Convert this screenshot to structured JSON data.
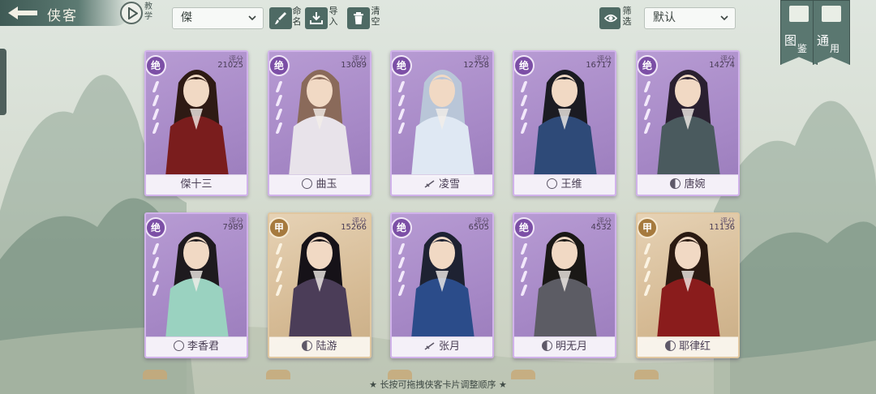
{
  "header": {
    "title": "侠客",
    "tutorial_label": "教学",
    "filter_select": "傑",
    "rename_label": "命名",
    "import_label": "导入",
    "clear_label": "清空",
    "screen_label": "筛选",
    "sort_select": "默认",
    "codex_label_1": "图",
    "codex_label_2": "鉴",
    "general_label_1": "通",
    "general_label_2": "用"
  },
  "score_label": "评分",
  "cards": [
    {
      "name": "傑十三",
      "rank": "绝",
      "tier": "jue",
      "score": "21025",
      "badge": "none"
    },
    {
      "name": "曲玉",
      "rank": "绝",
      "tier": "jue",
      "score": "13089",
      "badge": "lotus-icon"
    },
    {
      "name": "凌雪",
      "rank": "绝",
      "tier": "jue",
      "score": "12758",
      "badge": "sword-icon"
    },
    {
      "name": "王维",
      "rank": "绝",
      "tier": "jue",
      "score": "16717",
      "badge": "lotus-icon"
    },
    {
      "name": "唐婉",
      "rank": "绝",
      "tier": "jue",
      "score": "14274",
      "badge": "yinyang-icon"
    },
    {
      "name": "李香君",
      "rank": "绝",
      "tier": "jue",
      "score": "7989",
      "badge": "lotus-icon"
    },
    {
      "name": "陆游",
      "rank": "甲",
      "tier": "jia",
      "score": "15266",
      "badge": "yinyang-icon"
    },
    {
      "name": "张月",
      "rank": "绝",
      "tier": "jue",
      "score": "6505",
      "badge": "sword-icon"
    },
    {
      "name": "明无月",
      "rank": "绝",
      "tier": "jue",
      "score": "4532",
      "badge": "yinyang-icon"
    },
    {
      "name": "耶律红",
      "rank": "甲",
      "tier": "jia",
      "score": "11136",
      "badge": "yinyang-icon"
    }
  ],
  "hint": "★ 长按可拖拽侠客卡片调整顺序 ★",
  "colors": {
    "jue": "#a688c6",
    "jia": "#d6bb95",
    "toolbar": "#4e6a64"
  }
}
